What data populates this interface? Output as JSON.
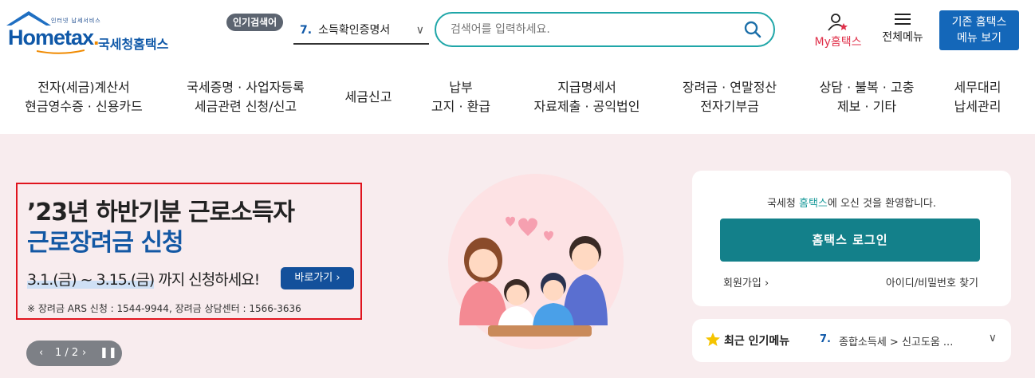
{
  "header": {
    "logo_small": "인터넷 납세서비스",
    "logo_brand": "Hometax",
    "logo_kr": "국세청홈택스",
    "popular_label": "인기검색어",
    "popular_num": "7.",
    "popular_term": "소득확인증명서",
    "search_placeholder": "검색어를 입력하세요.",
    "my_label": "My홈택스",
    "menu_label": "전체메뉴",
    "old_line1": "기존 홈택스",
    "old_line2": "메뉴 보기"
  },
  "nav": [
    {
      "l1": "전자(세금)계산서",
      "l2": "현금영수증 · 신용카드"
    },
    {
      "l1": "국세증명 · 사업자등록",
      "l2": "세금관련 신청/신고"
    },
    {
      "l1": "세금신고",
      "l2": ""
    },
    {
      "l1": "납부",
      "l2": "고지 · 환급"
    },
    {
      "l1": "지급명세서",
      "l2": "자료제출 · 공익법인"
    },
    {
      "l1": "장려금 · 연말정산",
      "l2": "전자기부금"
    },
    {
      "l1": "상담 · 불복 · 고충",
      "l2": "제보 · 기타"
    },
    {
      "l1": "세무대리",
      "l2": "납세관리"
    }
  ],
  "promo": {
    "line1": "’23년 하반기분 근로소득자",
    "line2": "근로장려금 신청",
    "period": "3.1.(금) ~ 3.15.(금)",
    "period_suffix": " 까지 신청하세요!",
    "go_label": "바로가기",
    "note": "※ 장려금 ARS 신청 : 1544-9944, 장려금 상담센터 : 1566-3636"
  },
  "pager": {
    "text": "1 / 2"
  },
  "login": {
    "welcome_pre": "국세청 ",
    "welcome_brand": "홈택스",
    "welcome_post": "에 오신 것을 환영합니다.",
    "button": "홈택스 로그인",
    "join": "회원가입",
    "find": "아이디/비밀번호 찾기"
  },
  "recent": {
    "title": "최근 인기메뉴",
    "num": "7.",
    "value": "종합소득세 > 신고도움 ..."
  },
  "colors": {
    "accent": "#1fa6a8",
    "brand": "#0f58a8",
    "login": "#13808a",
    "hero_bg": "#f8ecee",
    "alert": "#e0141e"
  }
}
